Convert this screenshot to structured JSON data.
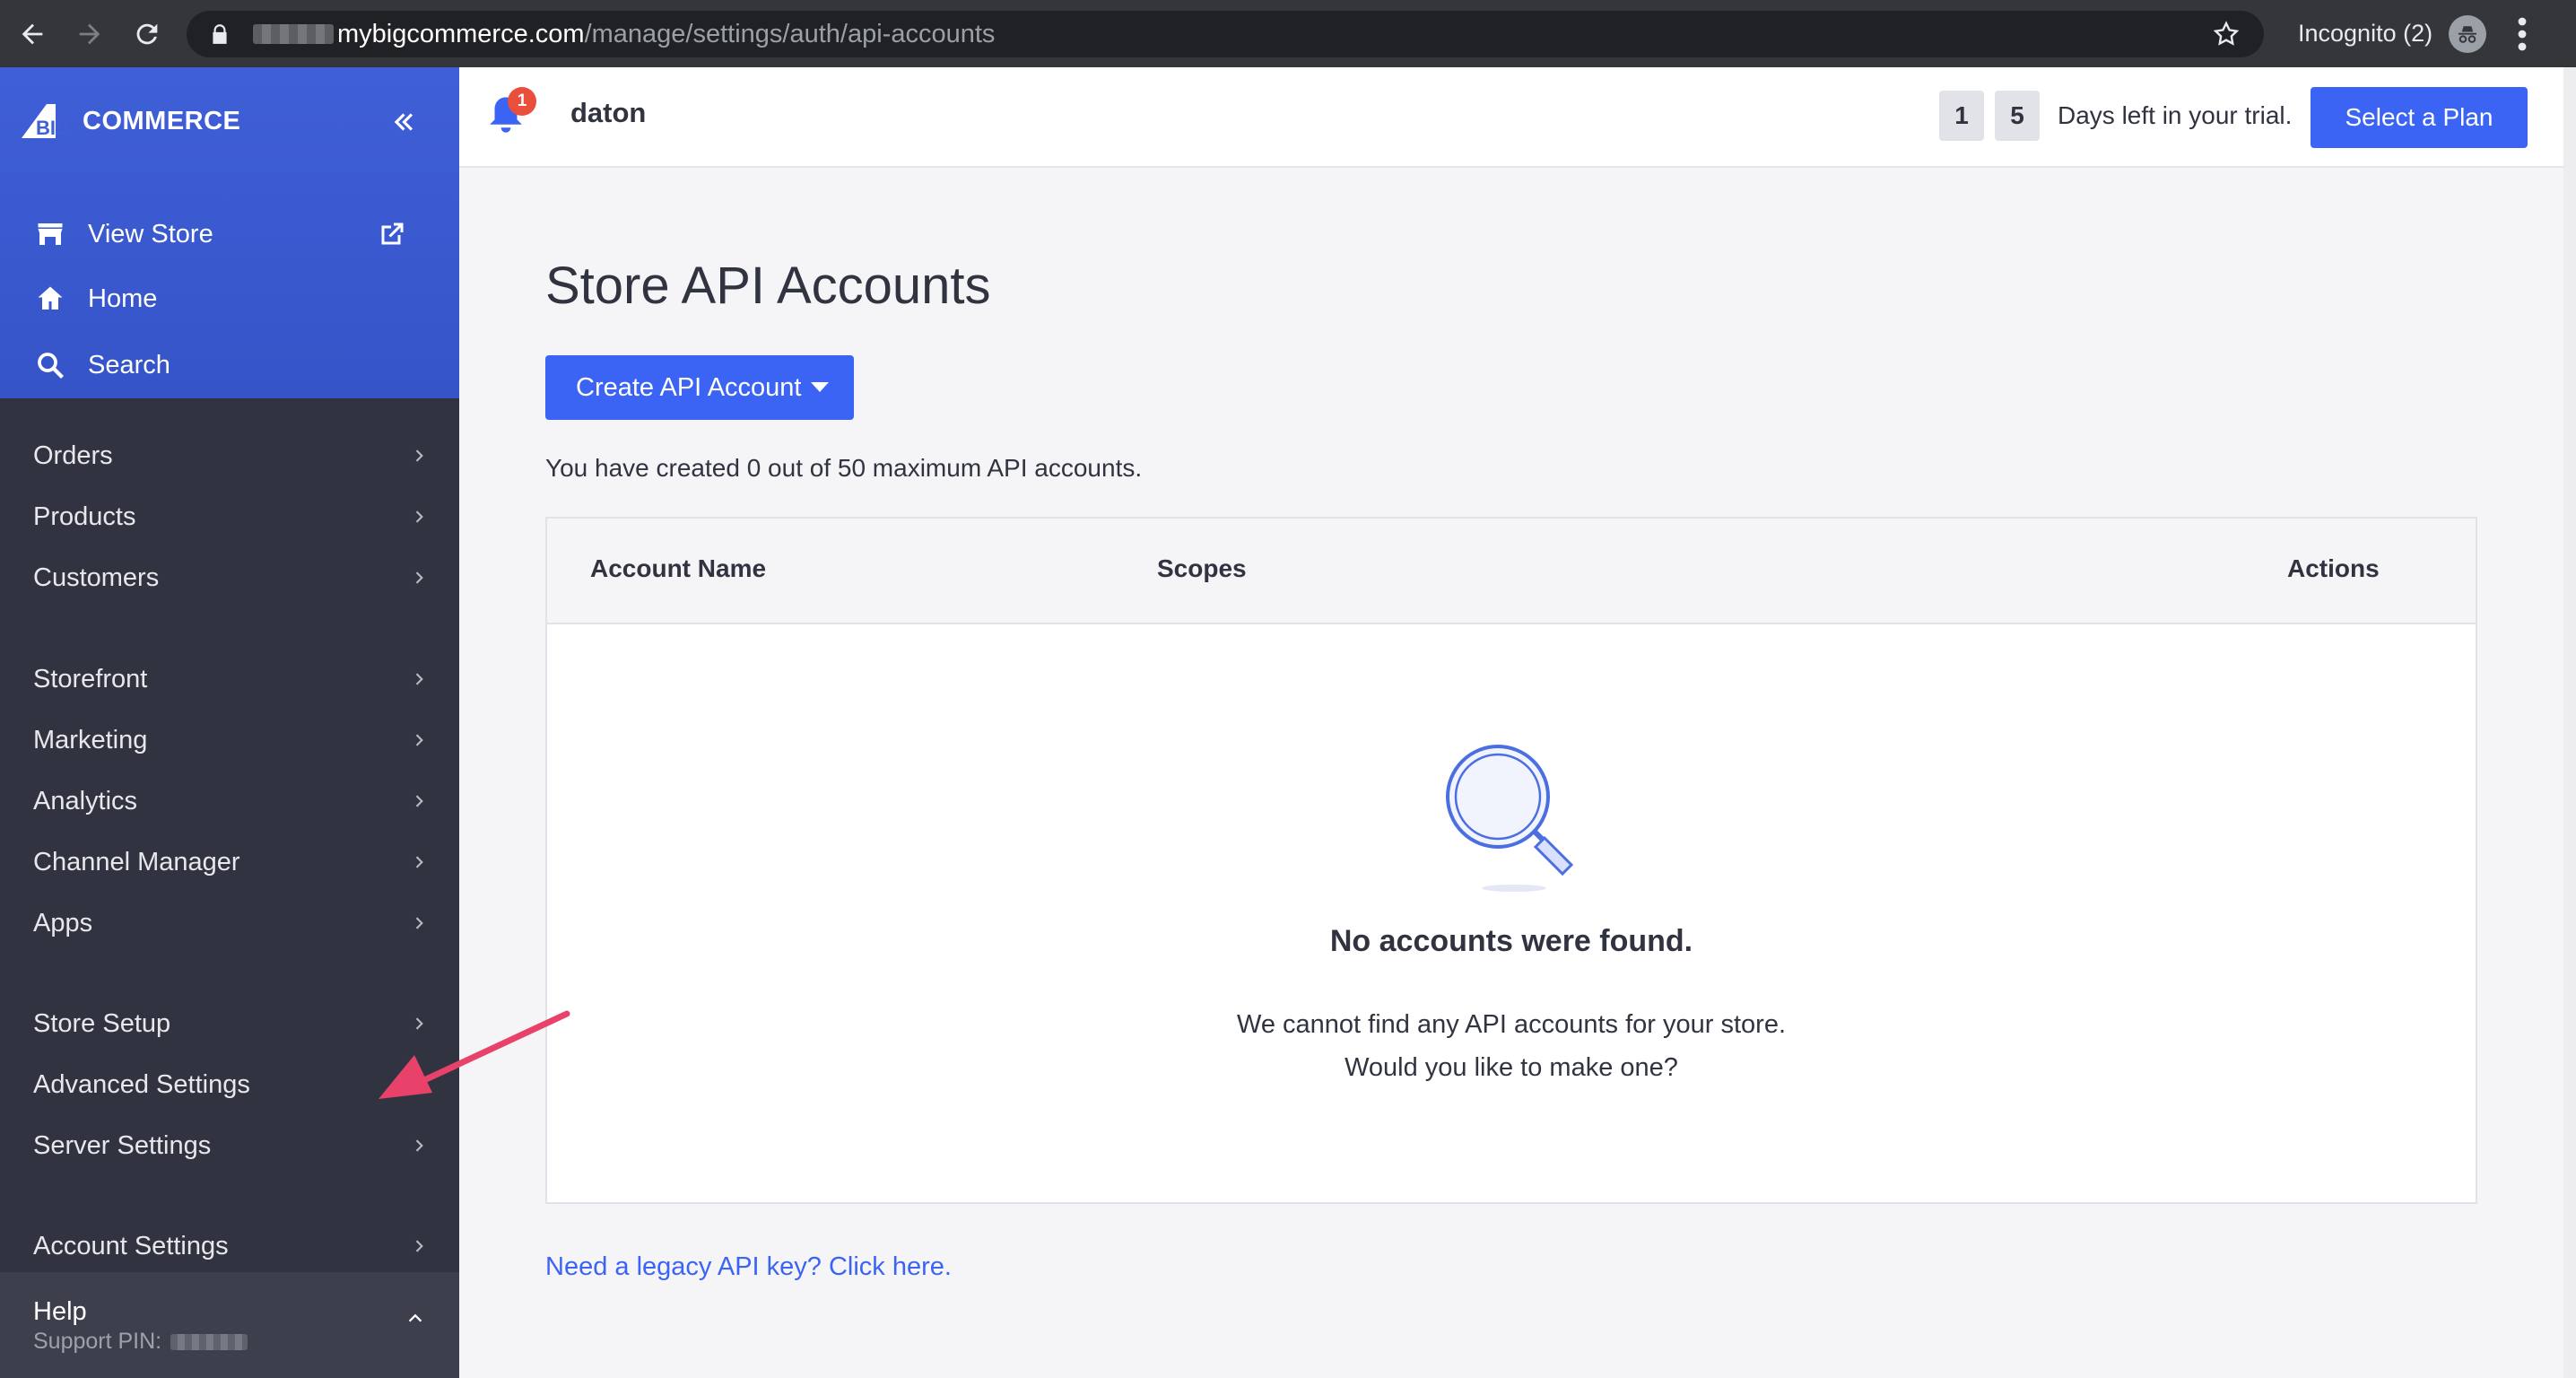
{
  "browser": {
    "url_host": "mybigcommerce.com",
    "url_path": "/manage/settings/auth/api-accounts",
    "profile_label": "Incognito (2)"
  },
  "sidebar": {
    "logo_text": "COMMERCE",
    "logo_prefix": "BIG",
    "top_items": [
      {
        "label": "View Store",
        "icon": "storefront-icon"
      },
      {
        "label": "Home",
        "icon": "home-icon"
      },
      {
        "label": "Search",
        "icon": "search-icon"
      }
    ],
    "groups": [
      [
        "Orders",
        "Products",
        "Customers"
      ],
      [
        "Storefront",
        "Marketing",
        "Analytics",
        "Channel Manager",
        "Apps"
      ],
      [
        "Store Setup",
        "Advanced Settings",
        "Server Settings"
      ],
      [
        "Account Settings"
      ]
    ],
    "help": {
      "label": "Help",
      "pin_label": "Support PIN:"
    }
  },
  "header": {
    "notification_count": "1",
    "store_name": "daton",
    "trial_digits": [
      "1",
      "5"
    ],
    "trial_text": "Days left in your trial.",
    "plan_button": "Select a Plan"
  },
  "main": {
    "title": "Store API Accounts",
    "create_button": "Create API Account",
    "quota_text": "You have created 0 out of 50 maximum API accounts.",
    "table": {
      "columns": [
        "Account Name",
        "Scopes",
        "Actions"
      ],
      "empty_title": "No accounts were found.",
      "empty_line1": "We cannot find any API accounts for your store.",
      "empty_line2": "Would you like to make one?"
    },
    "legacy_link": "Need a legacy API key? Click here."
  },
  "colors": {
    "accent": "#3c64f4",
    "sidebar_dark": "#313440",
    "annotation_arrow": "#e8426a"
  }
}
